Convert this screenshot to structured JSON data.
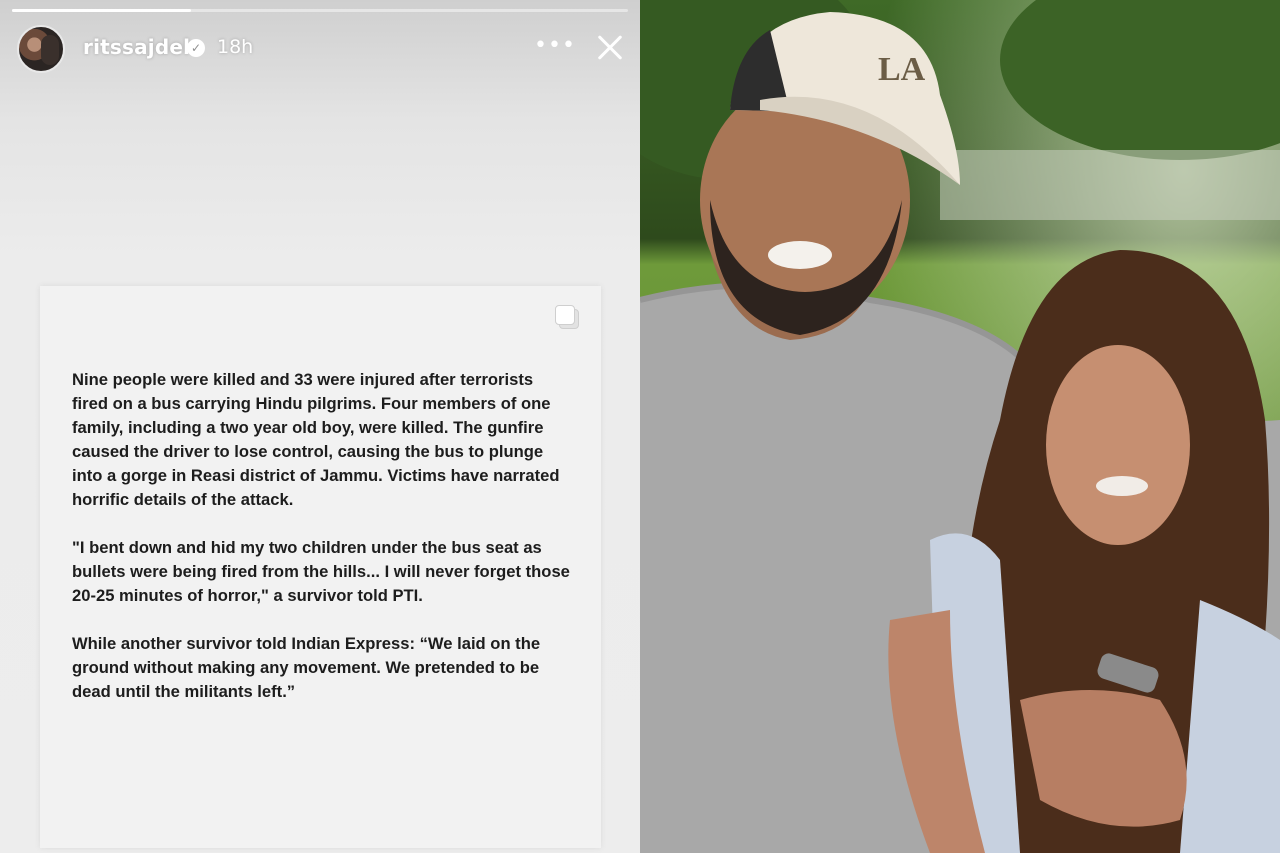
{
  "story": {
    "progress": 0.29,
    "username": "ritssajdeh",
    "timestamp": "18h",
    "more_label": "•••",
    "verified_label": "✓",
    "card": {
      "paragraphs": [
        "Nine people were killed and 33 were injured after terrorists fired on a bus carrying Hindu pilgrims. Four members of one family, including a two year old boy, were killed. The gunfire caused the driver to lose control, causing the bus to plunge into a gorge in Reasi district of Jammu. Victims have narrated horrific details of the attack.",
        "\"I bent down and hid my two children under the bus seat as bullets were being fired from the hills... I will never forget those 20-25 minutes of horror,\" a survivor told PTI.",
        "While another survivor told Indian Express: “We laid on the ground without making any movement. We pretended to be dead until the militants left.”"
      ]
    }
  },
  "photo": {
    "cap_logo": "LA",
    "colors": {
      "grass": "#5f8f2e",
      "trees": "#2f4f1e",
      "shirt": "#a9a9a9",
      "cap": "#efe8dc"
    }
  }
}
